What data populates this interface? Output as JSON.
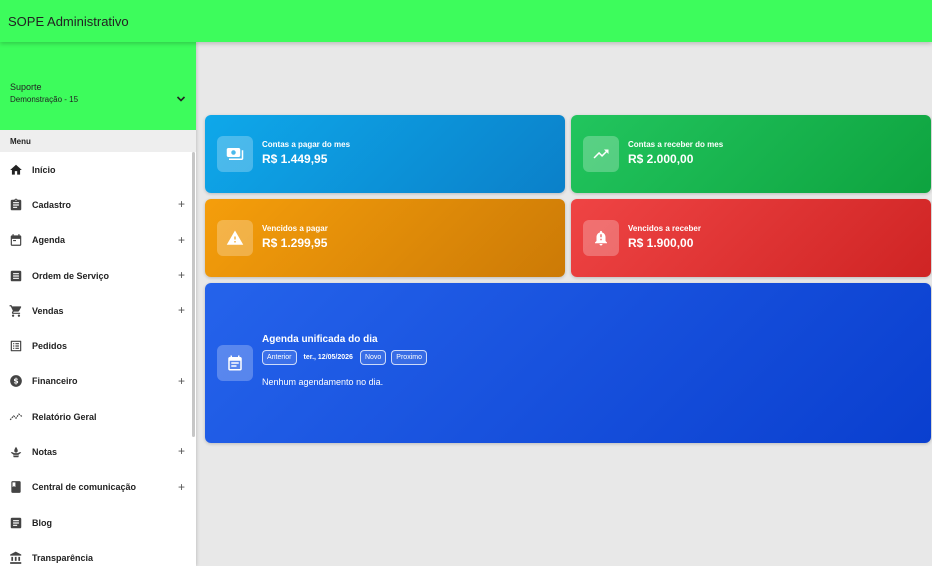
{
  "header": {
    "title": "SOPE Administrativo"
  },
  "profile": {
    "name": "Suporte",
    "subtitle": "Demonstração - 15"
  },
  "menu": {
    "heading": "Menu",
    "items": [
      {
        "label": "Início",
        "icon": "home-icon",
        "expandable": false
      },
      {
        "label": "Cadastro",
        "icon": "clipboard-icon",
        "expandable": true
      },
      {
        "label": "Agenda",
        "icon": "calendar-icon",
        "expandable": true
      },
      {
        "label": "Ordem de Serviço",
        "icon": "list-icon",
        "expandable": true
      },
      {
        "label": "Vendas",
        "icon": "cart-icon",
        "expandable": true
      },
      {
        "label": "Pedidos",
        "icon": "receipt-icon",
        "expandable": false
      },
      {
        "label": "Financeiro",
        "icon": "money-icon",
        "expandable": true
      },
      {
        "label": "Relatório Geral",
        "icon": "trend-icon",
        "expandable": false
      },
      {
        "label": "Notas",
        "icon": "hand-icon",
        "expandable": true
      },
      {
        "label": "Central de comunicação",
        "icon": "book-icon",
        "expandable": true
      },
      {
        "label": "Blog",
        "icon": "article-icon",
        "expandable": false
      },
      {
        "label": "Transparência",
        "icon": "bank-icon",
        "expandable": false
      }
    ]
  },
  "cards": {
    "pay_month": {
      "label": "Contas a pagar do mes",
      "value": "R$ 1.449,95",
      "icon": "cash-icon"
    },
    "receive_month": {
      "label": "Contas a receber do mes",
      "value": "R$ 2.000,00",
      "icon": "trend-up-icon"
    },
    "overdue_pay": {
      "label": "Vencidos a pagar",
      "value": "R$ 1.299,95",
      "icon": "warning-icon"
    },
    "overdue_receive": {
      "label": "Vencidos a receber",
      "value": "R$ 1.900,00",
      "icon": "bell-alert-icon"
    }
  },
  "agenda": {
    "title": "Agenda unificada do dia",
    "prev_label": "Anterior",
    "date": "ter., 12/05/2026",
    "new_label": "Novo",
    "next_label": "Proximo",
    "empty_text": "Nenhum agendamento no dia.",
    "icon": "event-icon"
  },
  "colors": {
    "brand": "#3dfc5c",
    "card_blue": "#0ea8ea",
    "card_green": "#22c55e",
    "card_orange": "#f59e0b",
    "card_red": "#ef4444",
    "agenda_blue": "#2563eb"
  }
}
